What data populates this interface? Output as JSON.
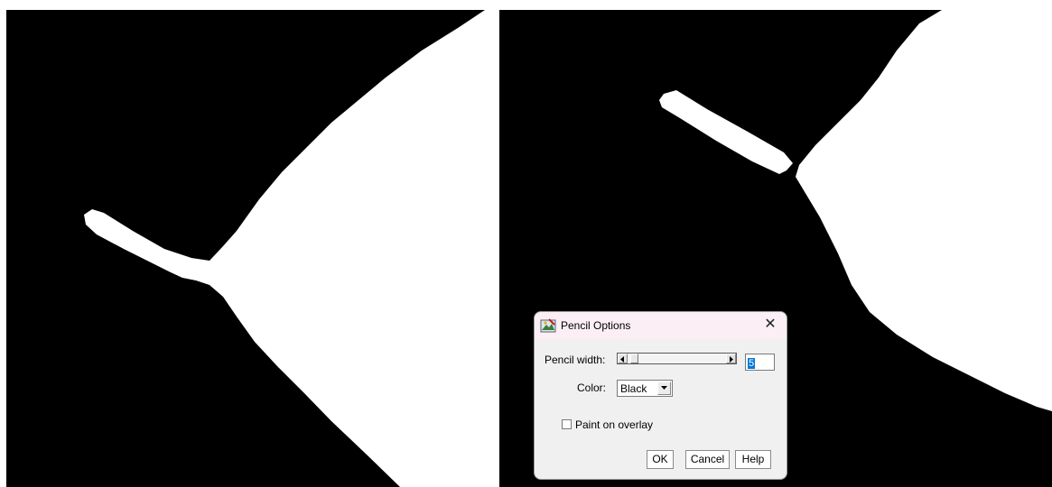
{
  "dialog": {
    "title": "Pencil Options",
    "close_glyph": "✕",
    "pencil_width_label": "Pencil width:",
    "pencil_width_value": "5",
    "color_label": "Color:",
    "color_value": "Black",
    "overlay_checkbox_label": "Paint on overlay",
    "overlay_checked": false,
    "ok_label": "OK",
    "cancel_label": "Cancel",
    "help_label": "Help"
  },
  "icons": {
    "app": "imagej-app-icon",
    "close": "close-icon",
    "scroll_left": "arrow-left-icon",
    "scroll_right": "arrow-right-icon",
    "dropdown": "chevron-down-icon"
  },
  "colors": {
    "image_background": "#000000",
    "image_foreground": "#ffffff",
    "dialog_background": "#f0f0f0",
    "titlebar_background": "#fbeef5",
    "selection_highlight": "#0078d7"
  }
}
